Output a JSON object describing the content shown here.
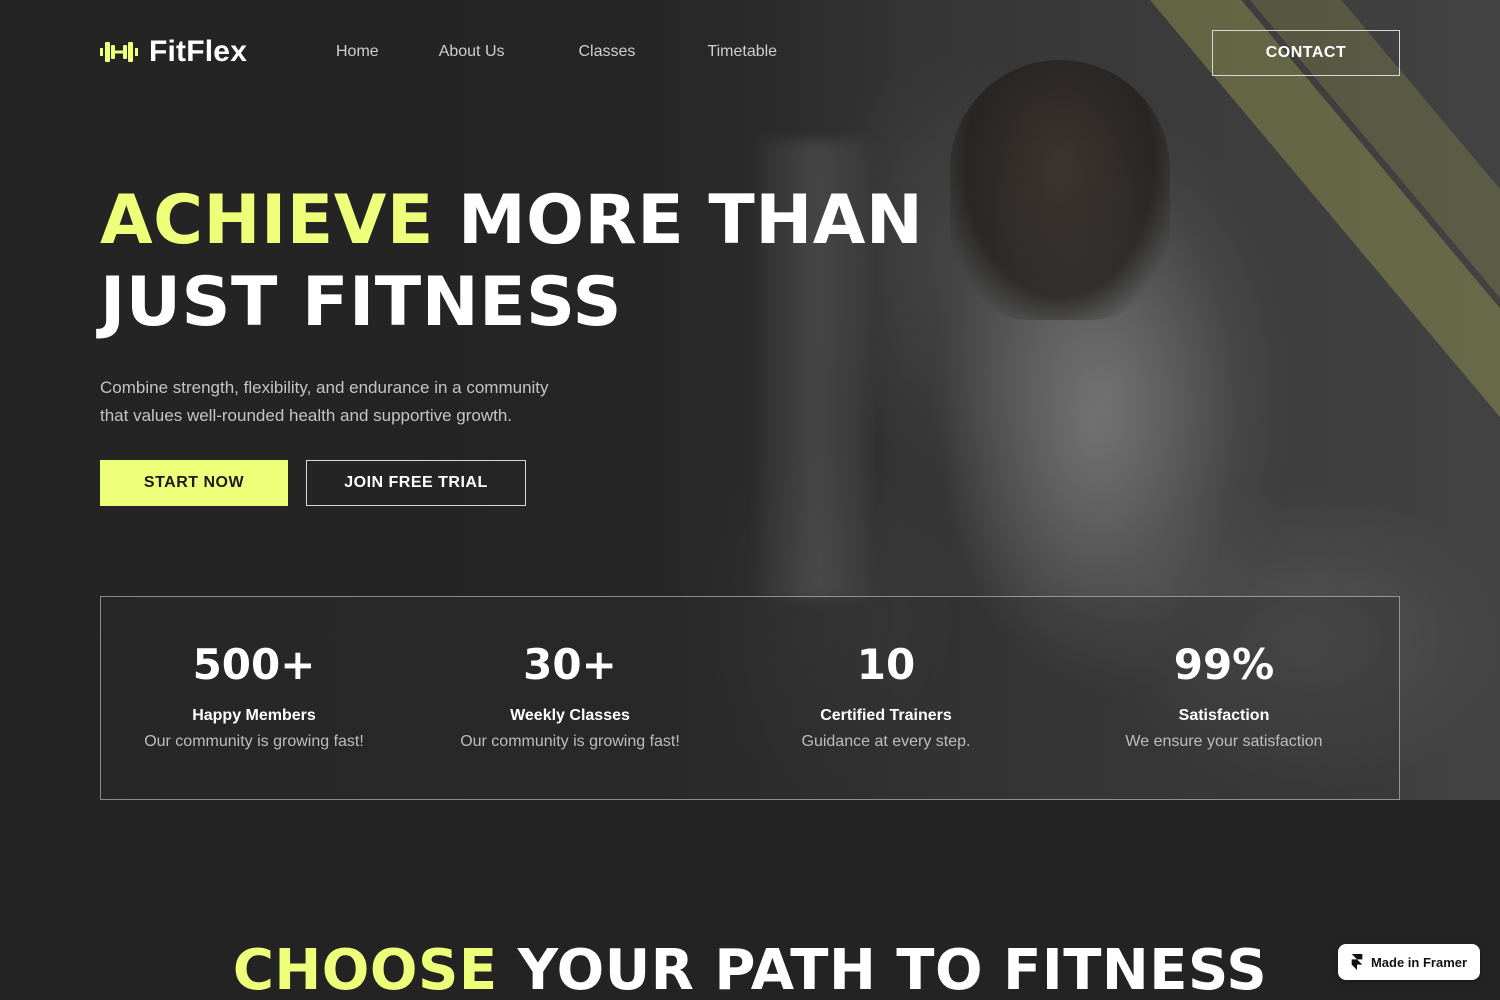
{
  "brand": {
    "name": "FitFlex",
    "accent_color": "#eeff7a",
    "logo_icon": "dumbbell-icon"
  },
  "nav": {
    "links": [
      "Home",
      "About Us",
      "Classes",
      "Timetable"
    ],
    "contact_label": "CONTACT"
  },
  "hero": {
    "title_accent": "ACHIEVE",
    "title_rest_line1": "MORE THAN",
    "title_line2": "JUST FITNESS",
    "subtitle_line1": "Combine strength, flexibility, and endurance in a community",
    "subtitle_line2": "that values well-rounded health and supportive growth.",
    "primary_cta": "START NOW",
    "secondary_cta": "JOIN FREE TRIAL"
  },
  "stats": [
    {
      "value": "500+",
      "label": "Happy Members",
      "desc": "Our community is growing fast!"
    },
    {
      "value": "30+",
      "label": "Weekly Classes",
      "desc": "Our community is growing fast!"
    },
    {
      "value": "10",
      "label": "Certified Trainers",
      "desc": "Guidance at every step."
    },
    {
      "value": "99%",
      "label": "Satisfaction",
      "desc": "We ensure your satisfaction"
    }
  ],
  "section": {
    "title_accent": "CHOOSE",
    "title_rest": "YOUR PATH TO FITNESS"
  },
  "badge": {
    "label": "Made in Framer",
    "icon": "framer-icon"
  }
}
